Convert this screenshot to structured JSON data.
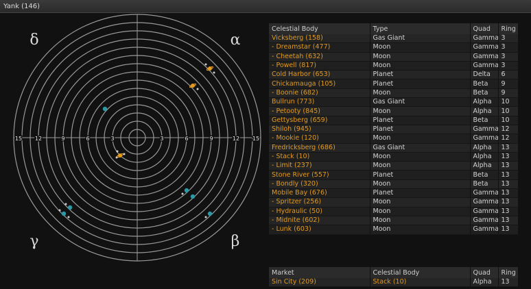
{
  "window": {
    "title": "Yank (146)"
  },
  "radar": {
    "quadrant_labels": {
      "top_left": "δ",
      "top_right": "α",
      "bottom_left": "γ",
      "bottom_right": "β"
    },
    "ring_labels_left": [
      "15",
      "12",
      "9",
      "6",
      "3"
    ],
    "ring_labels_right": [
      "3",
      "6",
      "9",
      "12",
      "15"
    ],
    "colors": {
      "ring": "#9a9a9a",
      "background": "#111111",
      "planet": "#2a9aa6",
      "gas_giant": "#e39a1f",
      "moon": "#d0d0d0"
    },
    "bodies": [
      {
        "name": "Vicksberg",
        "kind": "gas_giant",
        "icon": "ringed-planet-icon"
      },
      {
        "name": "Cold Harbor",
        "kind": "gas_giant",
        "icon": "ringed-planet-icon"
      },
      {
        "name": "Bullrun",
        "kind": "gas_giant",
        "icon": "ringed-planet-icon"
      },
      {
        "name": "Gettysberg",
        "kind": "planet",
        "icon": "planet-icon"
      },
      {
        "name": "Chickamauga",
        "kind": "planet",
        "icon": "planet-icon"
      },
      {
        "name": "Shiloh",
        "kind": "planet",
        "icon": "planet-icon"
      },
      {
        "name": "Stone River",
        "kind": "planet",
        "icon": "planet-icon"
      },
      {
        "name": "Mobile Bay",
        "kind": "planet",
        "icon": "planet-icon"
      }
    ]
  },
  "bodies_table": {
    "columns": [
      "Celestial Body",
      "Type",
      "Quad",
      "Ring"
    ],
    "rows": [
      [
        "Vicksberg (158)",
        "Gas Giant",
        "Gamma",
        "3"
      ],
      [
        "- Dreamstar (477)",
        "Moon",
        "Gamma",
        "3"
      ],
      [
        "- Cheetah (632)",
        "Moon",
        "Gamma",
        "3"
      ],
      [
        "- Powell (817)",
        "Moon",
        "Gamma",
        "3"
      ],
      [
        "Cold Harbor (653)",
        "Planet",
        "Delta",
        "6"
      ],
      [
        "Chickamauga (105)",
        "Planet",
        "Beta",
        "9"
      ],
      [
        "- Boonie (682)",
        "Moon",
        "Beta",
        "9"
      ],
      [
        "Bullrun (773)",
        "Gas Giant",
        "Alpha",
        "10"
      ],
      [
        "- Petooty (845)",
        "Moon",
        "Alpha",
        "10"
      ],
      [
        "Gettysberg (659)",
        "Planet",
        "Beta",
        "10"
      ],
      [
        "Shiloh (945)",
        "Planet",
        "Gamma",
        "12"
      ],
      [
        "- Mookie (120)",
        "Moon",
        "Gamma",
        "12"
      ],
      [
        "Fredricksberg (686)",
        "Gas Giant",
        "Alpha",
        "13"
      ],
      [
        "- Stack (10)",
        "Moon",
        "Alpha",
        "13"
      ],
      [
        "- Limit (237)",
        "Moon",
        "Alpha",
        "13"
      ],
      [
        "Stone River (557)",
        "Planet",
        "Beta",
        "13"
      ],
      [
        "- Bondly (320)",
        "Moon",
        "Beta",
        "13"
      ],
      [
        "Mobile Bay (676)",
        "Planet",
        "Gamma",
        "13"
      ],
      [
        "- Spritzer (256)",
        "Moon",
        "Gamma",
        "13"
      ],
      [
        "- Hydraulic (50)",
        "Moon",
        "Gamma",
        "13"
      ],
      [
        "- Midnite (602)",
        "Moon",
        "Gamma",
        "13"
      ],
      [
        "- Lunk (603)",
        "Moon",
        "Gamma",
        "13"
      ]
    ]
  },
  "market_table": {
    "columns": [
      "Market",
      "Celestial Body",
      "Quad",
      "Ring"
    ],
    "rows": [
      [
        "Sin City (209)",
        "Stack (10)",
        "Alpha",
        "13"
      ]
    ]
  }
}
